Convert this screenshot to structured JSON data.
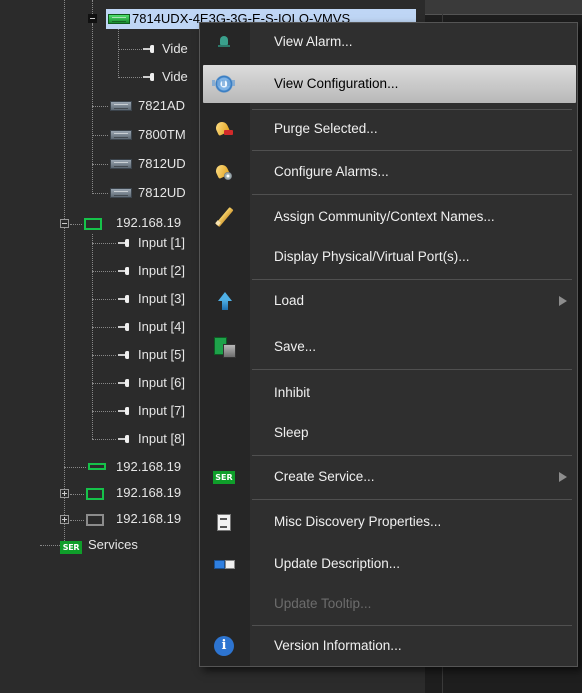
{
  "tree": {
    "rows": [
      {
        "label": "7814UDX-4E3G-3G-E-S-IOLO-VMVS"
      },
      {
        "label": "Vide"
      },
      {
        "label": "Vide"
      },
      {
        "label": "7821AD"
      },
      {
        "label": "7800TM"
      },
      {
        "label": "7812UD"
      },
      {
        "label": "7812UD"
      },
      {
        "label": "192.168.19"
      },
      {
        "label": "Input  [1]"
      },
      {
        "label": "Input  [2]"
      },
      {
        "label": "Input  [3]"
      },
      {
        "label": "Input  [4]"
      },
      {
        "label": "Input  [5]"
      },
      {
        "label": "Input  [6]"
      },
      {
        "label": "Input  [7]"
      },
      {
        "label": "Input  [8]"
      },
      {
        "label": "192.168.19"
      },
      {
        "label": "192.168.19"
      },
      {
        "label": "192.168.19"
      },
      {
        "label": "Services"
      }
    ],
    "ser_badge": "SER"
  },
  "context_menu": {
    "items": [
      {
        "label": "View Alarm...",
        "icon": "alarm-icon"
      },
      {
        "label": "View Configuration...",
        "icon": "configuration-icon",
        "highlighted": true
      },
      {
        "label": "Purge Selected...",
        "icon": "purge-icon"
      },
      {
        "label": "Configure Alarms...",
        "icon": "configure-alarms-icon"
      },
      {
        "label": "Assign Community/Context Names...",
        "icon": "pencil-icon"
      },
      {
        "label": "Display Physical/Virtual Port(s)..."
      },
      {
        "label": "Load",
        "icon": "load-arrow-icon",
        "submenu": true
      },
      {
        "label": "Save...",
        "icon": "save-icon"
      },
      {
        "label": "Inhibit"
      },
      {
        "label": "Sleep"
      },
      {
        "label": "Create Service...",
        "icon": "service-icon",
        "submenu": true
      },
      {
        "label": "Misc Discovery Properties...",
        "icon": "document-icon"
      },
      {
        "label": "Update Description...",
        "icon": "description-icon"
      },
      {
        "label": "Update Tooltip...",
        "disabled": true
      },
      {
        "label": "Version Information...",
        "icon": "info-icon"
      }
    ],
    "ser_badge": "SER",
    "info_glyph": "i"
  },
  "colors": {
    "background": "#2b2b2b",
    "menu_background": "#2f2f2f",
    "selected_row": "#bfd6f5",
    "highlight": "#c8c8c8",
    "disabled_text": "#6c6c6c",
    "green_badge": "#0f9e2a"
  }
}
